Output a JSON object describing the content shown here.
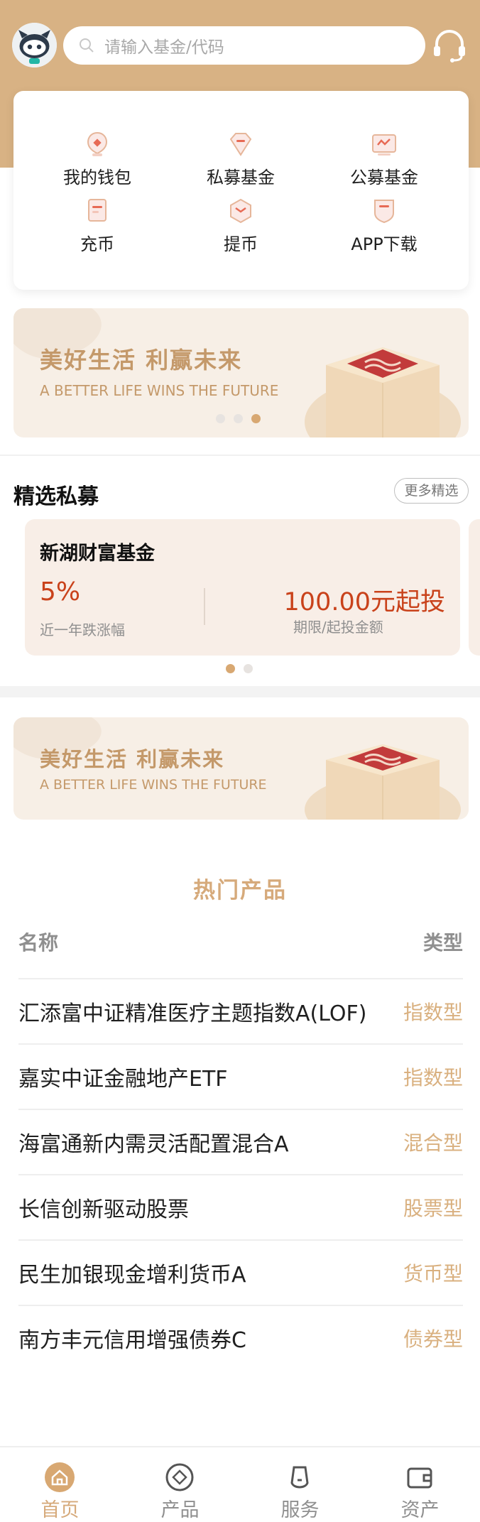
{
  "search": {
    "placeholder": "请输入基金/代码"
  },
  "quick_menu": [
    {
      "label": "我的钱包",
      "icon": "wallet-icon"
    },
    {
      "label": "私募基金",
      "icon": "diamond-icon"
    },
    {
      "label": "公募基金",
      "icon": "trend-icon"
    },
    {
      "label": "充币",
      "icon": "deposit-icon"
    },
    {
      "label": "提币",
      "icon": "withdraw-icon"
    },
    {
      "label": "APP下载",
      "icon": "download-icon"
    }
  ],
  "banner": {
    "title": "美好生活 利赢未来",
    "subtitle": "A BETTER LIFE WINS THE FUTURE",
    "slides": 3,
    "active_slide": 3
  },
  "private_section": {
    "title": "精选私募",
    "more_label": "更多精选",
    "fund": {
      "name": "新湖财富基金",
      "rate": "5%",
      "rate_label": "近一年跌涨幅",
      "min_invest": "100.00元起投",
      "min_label": "期限/起投金额"
    },
    "slides": 2,
    "active_slide": 1
  },
  "banner2": {
    "title": "美好生活 利赢未来",
    "subtitle": "A BETTER LIFE WINS THE FUTURE"
  },
  "hot_products": {
    "title": "热门产品",
    "col_name": "名称",
    "col_type": "类型",
    "rows": [
      {
        "name": "汇添富中证精准医疗主题指数A(LOF)",
        "type": "指数型"
      },
      {
        "name": "嘉实中证金融地产ETF",
        "type": "指数型"
      },
      {
        "name": "海富通新内需灵活配置混合A",
        "type": "混合型"
      },
      {
        "name": "长信创新驱动股票",
        "type": "股票型"
      },
      {
        "name": "民生加银现金增利货币A",
        "type": "货币型"
      },
      {
        "name": "南方丰元信用增强债券C",
        "type": "债券型"
      }
    ]
  },
  "tabs": [
    {
      "label": "首页",
      "icon": "home-icon",
      "active": true
    },
    {
      "label": "产品",
      "icon": "product-icon",
      "active": false
    },
    {
      "label": "服务",
      "icon": "service-icon",
      "active": false
    },
    {
      "label": "资产",
      "icon": "assets-icon",
      "active": false
    }
  ],
  "colors": {
    "brand": "#d8b284",
    "accent": "#d6aa7b",
    "price": "#c9421b"
  }
}
